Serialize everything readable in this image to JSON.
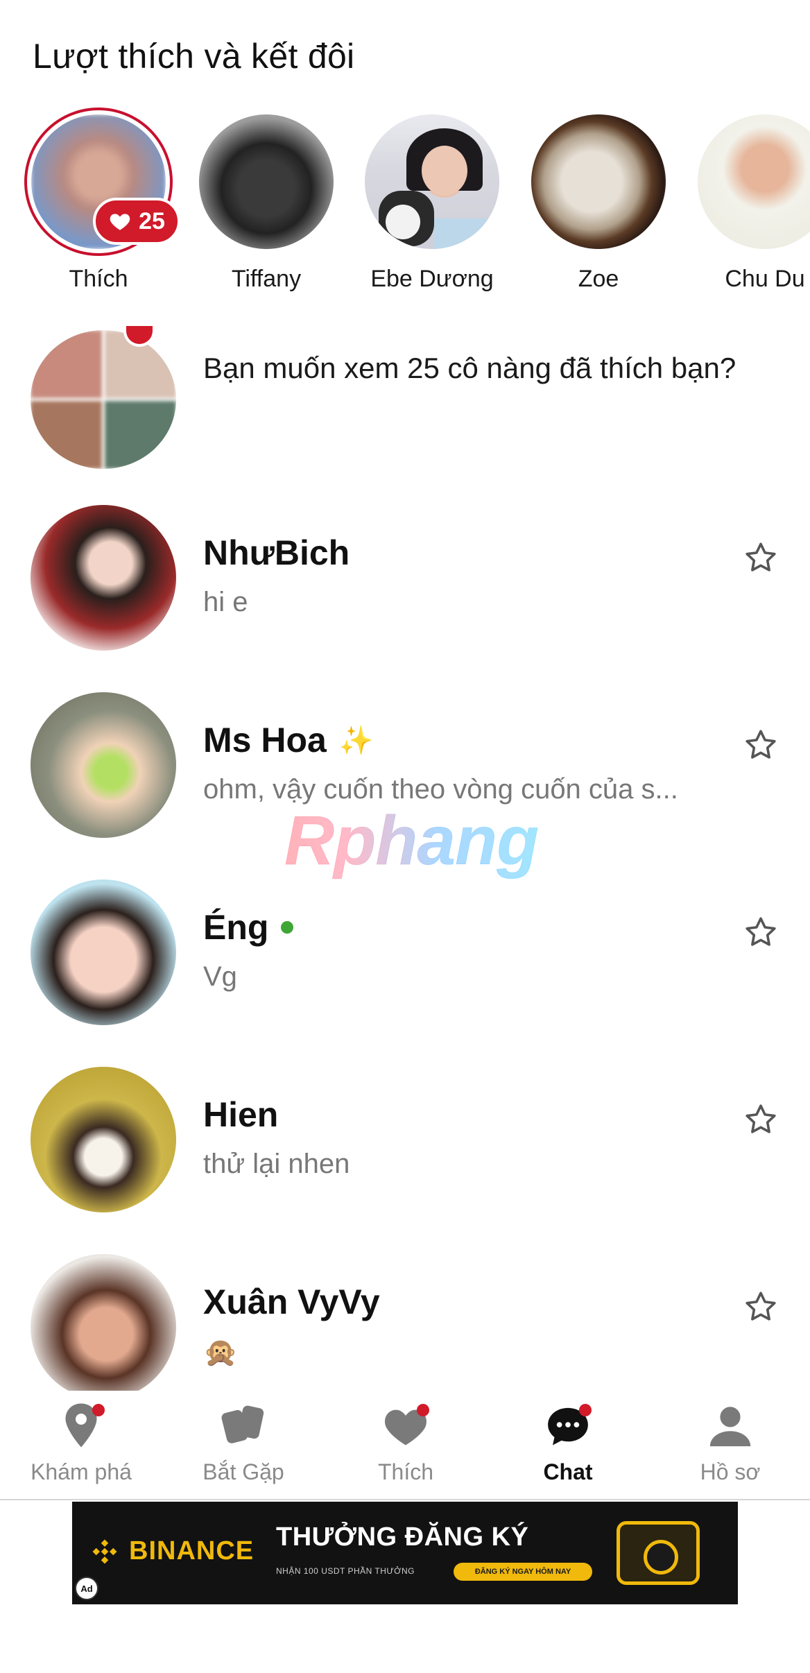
{
  "header": {
    "title": "Lượt thích và kết đôi"
  },
  "likes": {
    "items": [
      {
        "name": "Thích",
        "count": "25",
        "is_likes_counter": true
      },
      {
        "name": "Tiffany"
      },
      {
        "name": "Ebe Dương"
      },
      {
        "name": "Zoe"
      },
      {
        "name": "Chu Du"
      }
    ]
  },
  "promo": {
    "text": "Bạn muốn xem 25 cô nàng đã thích bạn?"
  },
  "chats": [
    {
      "name": "NhưBich",
      "message": "hi e",
      "badge": ""
    },
    {
      "name": "Ms Hoa",
      "message": "ohm, vậy cuốn theo vòng cuốn của s...",
      "badge": "✨"
    },
    {
      "name": "Éng",
      "message": "Vg",
      "online": true
    },
    {
      "name": "Hien",
      "message": "thử lại nhen"
    },
    {
      "name": "Xuân VyVy",
      "message": "🙊"
    }
  ],
  "watermark": {
    "text": "Rphang"
  },
  "nav": {
    "items": [
      {
        "label": "Khám phá",
        "has_dot": true
      },
      {
        "label": "Bắt Gặp",
        "has_dot": false
      },
      {
        "label": "Thích",
        "has_dot": true
      },
      {
        "label": "Chat",
        "has_dot": true,
        "active": true
      },
      {
        "label": "Hồ sơ",
        "has_dot": false
      }
    ]
  },
  "ad": {
    "brand": "BINANCE",
    "headline": "THƯỞNG ĐĂNG KÝ",
    "subline": "NHẬN 100 USDT PHẦN THƯỞNG",
    "cta": "ĐĂNG KÝ NGAY HÔM NAY",
    "choice_label": "Ad"
  },
  "colors": {
    "accent_red": "#d11a2a",
    "online_green": "#3fa535",
    "binance_yellow": "#f0b90b"
  }
}
